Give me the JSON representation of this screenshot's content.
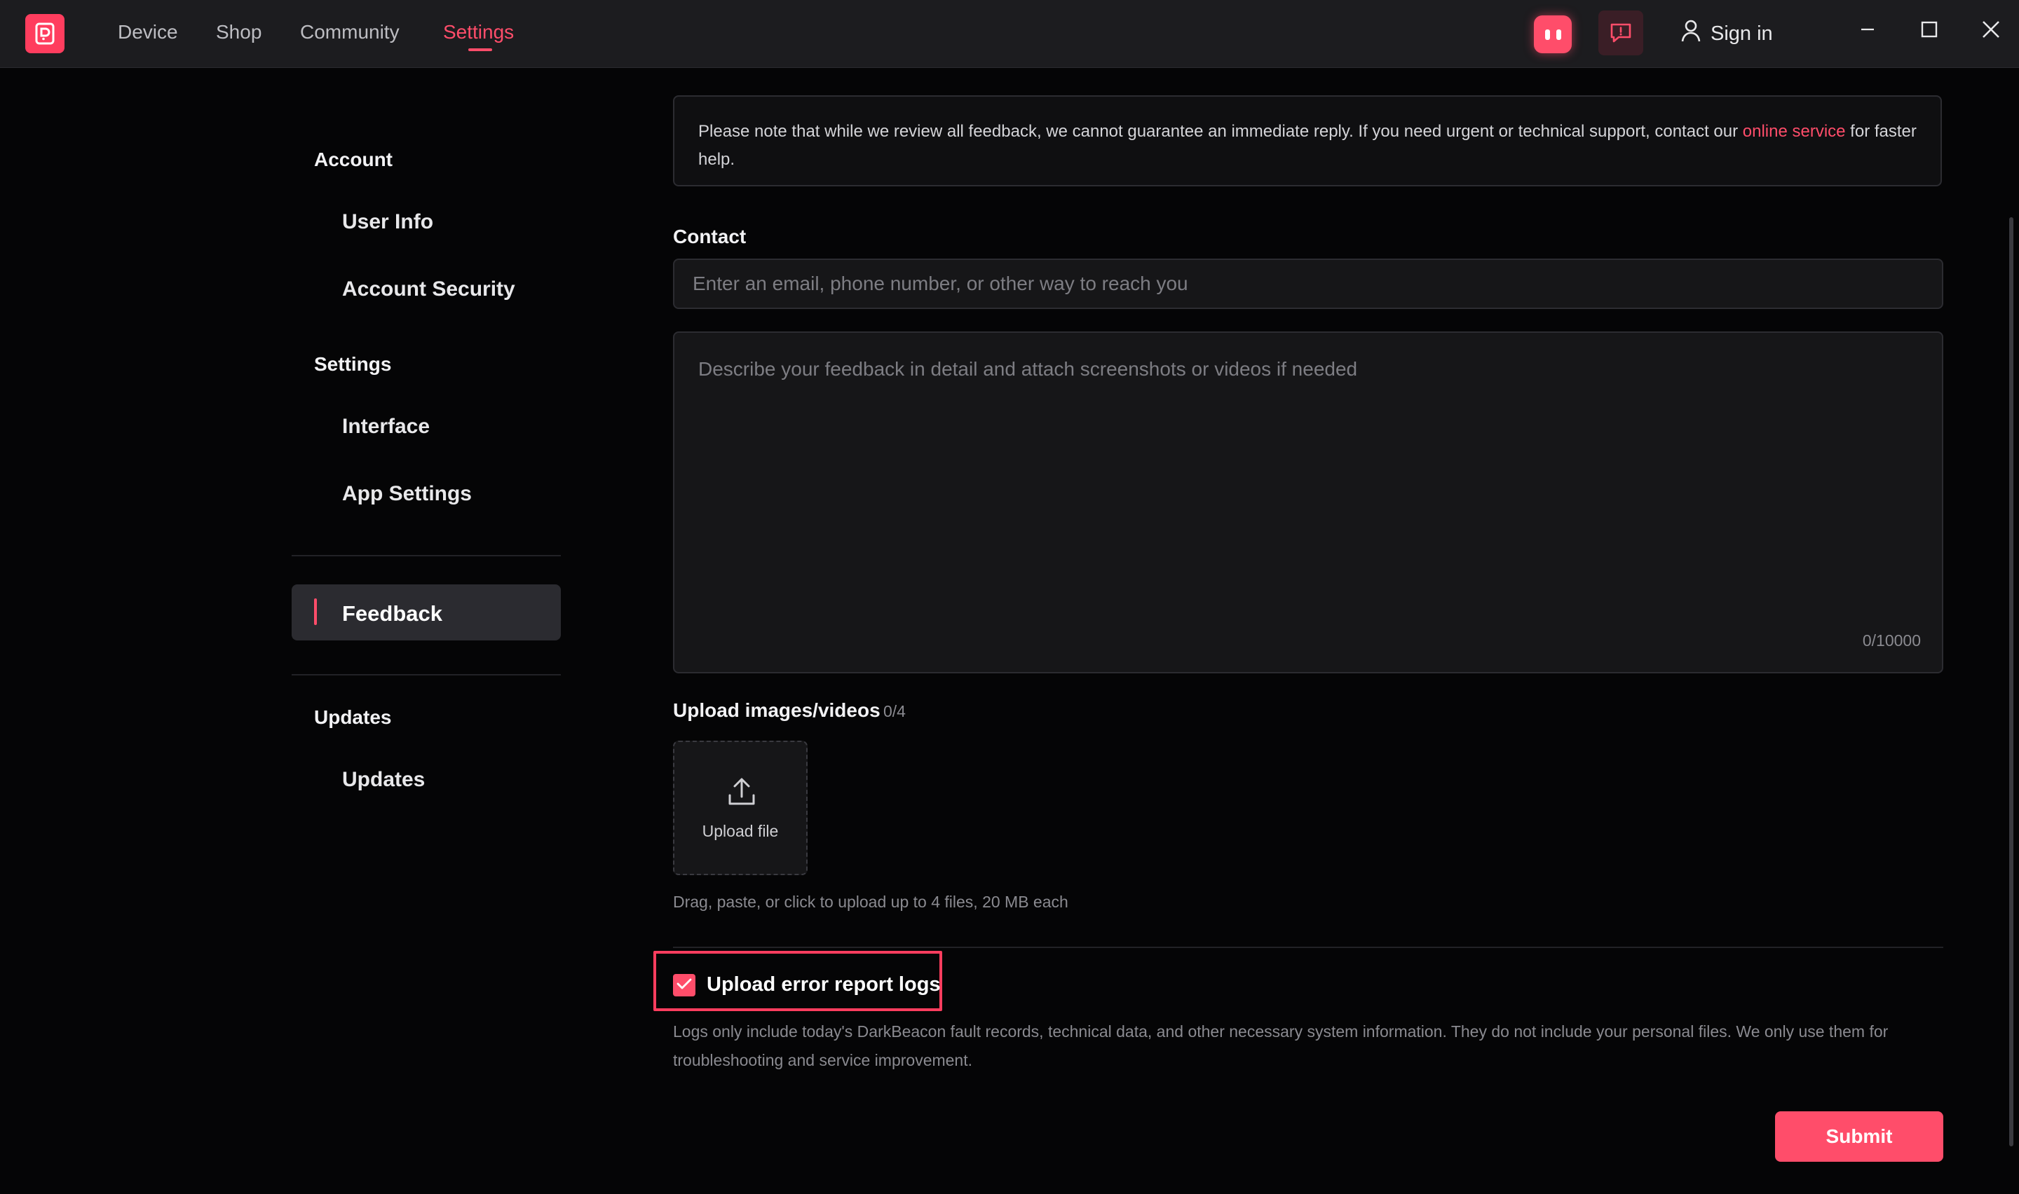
{
  "nav": {
    "tabs": [
      {
        "label": "Device"
      },
      {
        "label": "Shop"
      },
      {
        "label": "Community"
      },
      {
        "label": "Settings"
      }
    ],
    "active_tab": "Settings",
    "sign_in_label": "Sign in"
  },
  "sidebar": {
    "groups": [
      {
        "title": "Account",
        "items": [
          "User Info",
          "Account Security"
        ]
      },
      {
        "title": "Settings",
        "items": [
          "Interface",
          "App Settings"
        ]
      },
      {
        "title": "",
        "items": [
          "Feedback"
        ]
      },
      {
        "title": "Updates",
        "items": [
          "Updates"
        ]
      }
    ],
    "active_item": "Feedback"
  },
  "feedback": {
    "notice_text": "Please note that while we review all feedback, we cannot guarantee an immediate reply. If you need urgent or technical support, contact our ",
    "notice_link": "online service",
    "notice_tail": " for faster help.",
    "contact_label": "Contact",
    "contact_placeholder": "Enter an email, phone number, or other way to reach you",
    "contact_value": "",
    "description_placeholder": "Describe your feedback in detail and attach screenshots or videos if needed",
    "description_value": "",
    "char_counter": "0/10000",
    "upload_label": "Upload images/videos",
    "upload_count": "0/4",
    "upload_button_label": "Upload file",
    "upload_hint": "Drag, paste, or click to upload up to 4 files, 20 MB each",
    "logs_checkbox_label": "Upload error report logs",
    "logs_checked": true,
    "logs_description": "Logs only include today's DarkBeacon fault records, technical data, and other necessary system information. They do not include your personal files. We only use them for troubleshooting and service improvement.",
    "submit_label": "Submit"
  },
  "icons": {
    "logo": "app-logo-icon",
    "assistant": "assistant-robot-icon",
    "feedback": "feedback-chat-icon",
    "user": "user-icon",
    "upload": "upload-arrow-icon",
    "check": "checkmark-icon",
    "minimize": "minimize-icon",
    "maximize": "maximize-icon",
    "close": "close-icon"
  },
  "colors": {
    "accent": "#ff4d6a",
    "background": "#050506",
    "topbar": "#1c1c1f",
    "panel": "#161618"
  }
}
